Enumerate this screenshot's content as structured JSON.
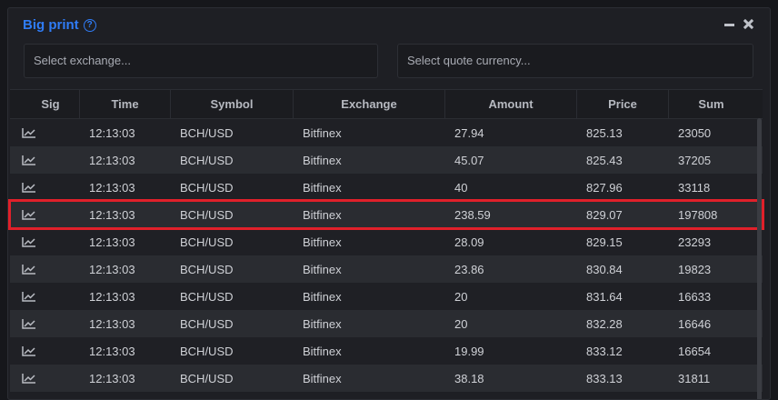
{
  "header": {
    "title": "Big print",
    "help_glyph": "?"
  },
  "filters": {
    "exchange_placeholder": "Select exchange...",
    "quote_placeholder": "Select quote currency..."
  },
  "table": {
    "columns": [
      "Sig",
      "Time",
      "Symbol",
      "Exchange",
      "Amount",
      "Price",
      "Sum"
    ],
    "rows": [
      {
        "time": "12:13:03",
        "symbol": "BCH/USD",
        "exchange": "Bitfinex",
        "amount": "27.94",
        "price": "825.13",
        "sum": "23050"
      },
      {
        "time": "12:13:03",
        "symbol": "BCH/USD",
        "exchange": "Bitfinex",
        "amount": "45.07",
        "price": "825.43",
        "sum": "37205"
      },
      {
        "time": "12:13:03",
        "symbol": "BCH/USD",
        "exchange": "Bitfinex",
        "amount": "40",
        "price": "827.96",
        "sum": "33118"
      },
      {
        "time": "12:13:03",
        "symbol": "BCH/USD",
        "exchange": "Bitfinex",
        "amount": "238.59",
        "price": "829.07",
        "sum": "197808"
      },
      {
        "time": "12:13:03",
        "symbol": "BCH/USD",
        "exchange": "Bitfinex",
        "amount": "28.09",
        "price": "829.15",
        "sum": "23293"
      },
      {
        "time": "12:13:03",
        "symbol": "BCH/USD",
        "exchange": "Bitfinex",
        "amount": "23.86",
        "price": "830.84",
        "sum": "19823"
      },
      {
        "time": "12:13:03",
        "symbol": "BCH/USD",
        "exchange": "Bitfinex",
        "amount": "20",
        "price": "831.64",
        "sum": "16633"
      },
      {
        "time": "12:13:03",
        "symbol": "BCH/USD",
        "exchange": "Bitfinex",
        "amount": "20",
        "price": "832.28",
        "sum": "16646"
      },
      {
        "time": "12:13:03",
        "symbol": "BCH/USD",
        "exchange": "Bitfinex",
        "amount": "19.99",
        "price": "833.12",
        "sum": "16654"
      },
      {
        "time": "12:13:03",
        "symbol": "BCH/USD",
        "exchange": "Bitfinex",
        "amount": "38.18",
        "price": "833.13",
        "sum": "31811"
      }
    ],
    "highlighted_row_index": 3,
    "sig_icon": "line-chart-icon"
  },
  "colors": {
    "accent": "#2f7cf6",
    "highlight_border": "#e0202a",
    "background": "#1e1f24"
  }
}
